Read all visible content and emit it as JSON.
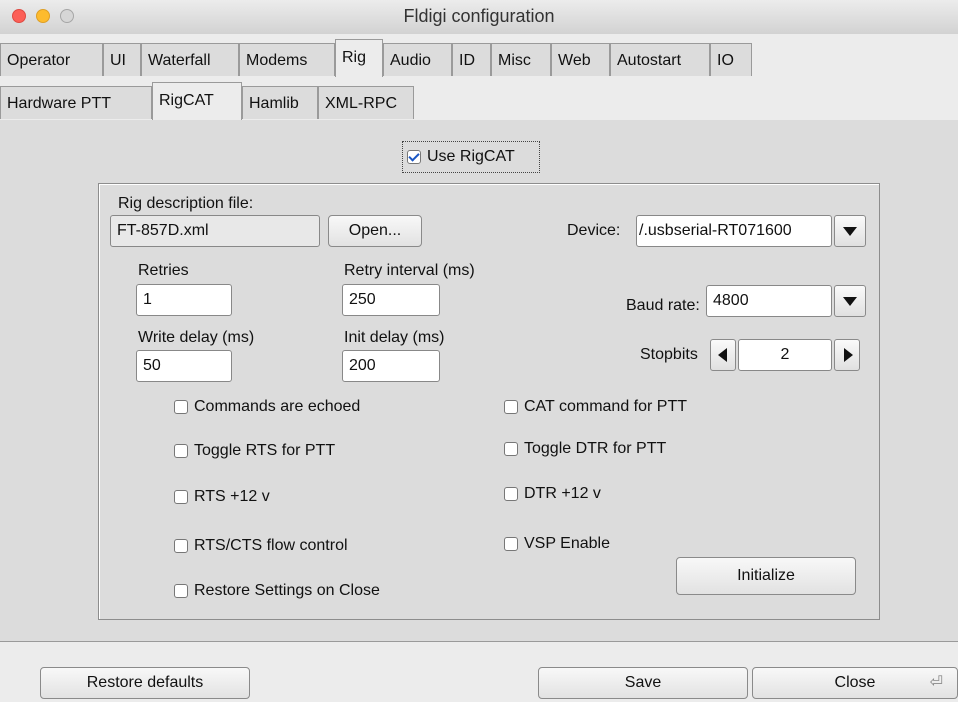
{
  "window": {
    "title": "Fldigi configuration"
  },
  "tabs_main": [
    {
      "label": "Operator"
    },
    {
      "label": "UI"
    },
    {
      "label": "Waterfall"
    },
    {
      "label": "Modems"
    },
    {
      "label": "Rig"
    },
    {
      "label": "Audio"
    },
    {
      "label": "ID"
    },
    {
      "label": "Misc"
    },
    {
      "label": "Web"
    },
    {
      "label": "Autostart"
    },
    {
      "label": "IO"
    }
  ],
  "tabs_sub": [
    {
      "label": "Hardware PTT"
    },
    {
      "label": "RigCAT"
    },
    {
      "label": "Hamlib"
    },
    {
      "label": "XML-RPC"
    }
  ],
  "rigcat": {
    "use_label": "Use RigCAT",
    "use_checked": true,
    "rig_desc_label": "Rig description file:",
    "rig_desc_value": "FT-857D.xml",
    "open_label": "Open...",
    "device_label": "Device:",
    "device_value": "/.usbserial-RT071600",
    "retries_label": "Retries",
    "retries_value": "1",
    "retry_interval_label": "Retry interval (ms)",
    "retry_interval_value": "250",
    "baud_label": "Baud rate:",
    "baud_value": "4800",
    "write_delay_label": "Write delay (ms)",
    "write_delay_value": "50",
    "init_delay_label": "Init delay (ms)",
    "init_delay_value": "200",
    "stopbits_label": "Stopbits",
    "stopbits_value": "2",
    "checks": {
      "commands_echoed": "Commands are echoed",
      "cat_ptt": "CAT command for PTT",
      "toggle_rts": "Toggle RTS for PTT",
      "toggle_dtr": "Toggle DTR for PTT",
      "rts_12v": "RTS +12 v",
      "dtr_12v": "DTR +12 v",
      "rts_cts": "RTS/CTS flow control",
      "vsp_enable": "VSP Enable",
      "restore_on_close": "Restore Settings on Close"
    },
    "initialize_label": "Initialize"
  },
  "footer": {
    "restore_defaults": "Restore defaults",
    "save": "Save",
    "close": "Close"
  },
  "colors": {
    "close_red": "#fc5f57",
    "minimize_yellow": "#fdbb2e",
    "zoom_inactive": "#d6d6d6"
  }
}
